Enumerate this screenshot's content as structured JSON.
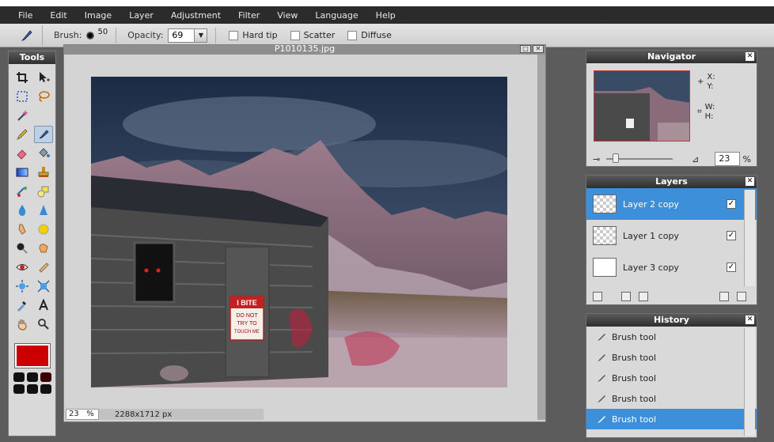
{
  "menu": [
    "File",
    "Edit",
    "Image",
    "Layer",
    "Adjustment",
    "Filter",
    "View",
    "Language",
    "Help"
  ],
  "options": {
    "brush_label": "Brush:",
    "brush_size": "50",
    "opacity_label": "Opacity:",
    "opacity_value": "69",
    "hard_tip": "Hard tip",
    "scatter": "Scatter",
    "diffuse": "Diffuse"
  },
  "tools_title": "Tools",
  "foreground_color": "#cc0000",
  "document": {
    "title": "P1010135.jpg",
    "zoom": "23",
    "zoom_unit": "%",
    "dimensions": "2288x1712 px"
  },
  "canvas_sign": {
    "line1": "I BITE",
    "line2": "DO NOT",
    "line3": "TRY TO",
    "line4": "TOUCH ME"
  },
  "navigator": {
    "title": "Navigator",
    "x_label": "X:",
    "y_label": "Y:",
    "w_label": "W:",
    "h_label": "H:",
    "zoom": "23",
    "zoom_unit": "%"
  },
  "layers": {
    "title": "Layers",
    "items": [
      {
        "name": "Layer 2 copy",
        "selected": true
      },
      {
        "name": "Layer 1 copy",
        "selected": false
      },
      {
        "name": "Layer 3 copy",
        "selected": false
      }
    ]
  },
  "history": {
    "title": "History",
    "items": [
      "Brush tool",
      "Brush tool",
      "Brush tool",
      "Brush tool",
      "Brush tool"
    ]
  },
  "colors": {
    "accent": "#3c8fd8",
    "menubar": "#2b2b2b",
    "panel_title": "#3a3a3a"
  }
}
